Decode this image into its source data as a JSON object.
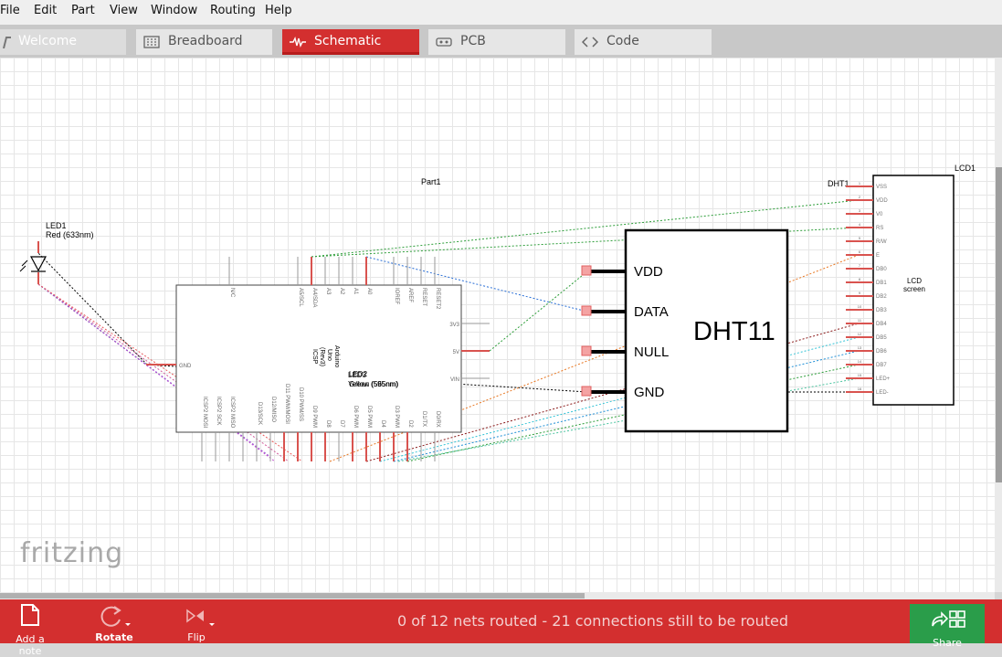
{
  "menu": [
    "File",
    "Edit",
    "Part",
    "View",
    "Window",
    "Routing",
    "Help"
  ],
  "tabs": [
    {
      "label": "Welcome",
      "active": false
    },
    {
      "label": "Breadboard",
      "active": false
    },
    {
      "label": "Schematic",
      "active": true
    },
    {
      "label": "PCB",
      "active": false
    },
    {
      "label": "Code",
      "active": false
    }
  ],
  "schematic": {
    "part1_label": "Part1",
    "led1": {
      "id": "LED1",
      "desc": "Red (633nm)"
    },
    "led_overlap": {
      "id": "LED3",
      "id2": "LED2",
      "desc": "Yellow (595nm)",
      "desc2": "Green (565nm)"
    },
    "arduino": {
      "name_lines": [
        "Arduino",
        "Uno",
        "(Rev3)",
        "ICSP"
      ],
      "top_pins": [
        "N/C",
        "A5/SCL",
        "A4/SDA",
        "A3",
        "A2",
        "A1",
        "A0",
        "IOREF",
        "AREF",
        "RESET",
        "RESET2"
      ],
      "right_pins": [
        "3V3",
        "5V",
        "VIN"
      ],
      "left_pins": [
        "GND"
      ],
      "bottom_pins": [
        "ICSP2 MOSI",
        "ICSP2 SCK",
        "ICSP2 MISO",
        "D13/SCK",
        "D12/MISO",
        "D11 PWM/MOSI",
        "D10 PWM/SS",
        "D9 PWM",
        "D8",
        "D7",
        "D6 PWM",
        "D5 PWM",
        "D4",
        "D3 PWM",
        "D2",
        "D1/TX",
        "D0/RX"
      ]
    },
    "dht11": {
      "id": "DHT1",
      "name": "DHT11",
      "pins": [
        "VDD",
        "DATA",
        "NULL",
        "GND"
      ]
    },
    "lcd": {
      "id": "LCD1",
      "title_lines": [
        "LCD",
        "screen"
      ],
      "pins": [
        "VSS",
        "VDD",
        "V0",
        "RS",
        "R/W",
        "E",
        "DB0",
        "DB1",
        "DB2",
        "DB3",
        "DB4",
        "DB5",
        "DB6",
        "DB7",
        "LED+",
        "LED-"
      ],
      "pin_numbers": [
        "1",
        "2",
        "3",
        "4",
        "5",
        "6",
        "7",
        "8",
        "9",
        "10",
        "11",
        "12",
        "13",
        "14",
        "15",
        "16"
      ]
    },
    "logo": "fritzing"
  },
  "bottom": {
    "add_note": "Add a note",
    "rotate": "Rotate",
    "flip": "Flip",
    "status": "0 of 12 nets routed - 21 connections still to be routed",
    "share": "Share"
  },
  "colors": {
    "accent": "#d32f2f",
    "share_green": "#2a9d4a",
    "pin_red": "#d9534f"
  }
}
